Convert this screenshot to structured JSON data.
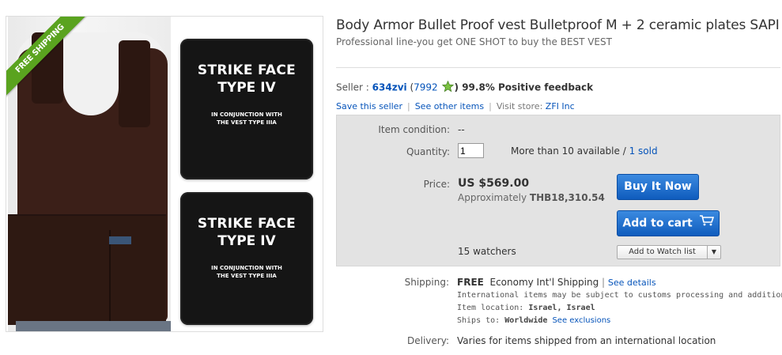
{
  "listing": {
    "title": "Body Armor Bullet Proof vest Bulletproof M + 2 ceramic plates SAPI",
    "subtitle": "Professional line-you get ONE SHOT to buy the BEST VEST"
  },
  "images": {
    "ribbon_text": "FREE SHIPPING",
    "plate_top": {
      "line1": "STRIKE FACE",
      "line2": "TYPE IV",
      "line3": "IN CONJUNCTION WITH",
      "line4": "THE VEST TYPE IIIA"
    },
    "plate_bottom": {
      "line1": "STRIKE FACE",
      "line2": "TYPE IV",
      "line3": "IN CONJUNCTION WITH",
      "line4": "THE VEST TYPE IIIA"
    }
  },
  "seller": {
    "label": "Seller :",
    "name": "634zvi",
    "score_open": "(",
    "score": "7992",
    "feedback": ") 99.8% Positive feedback",
    "star_icon": "green-star-icon",
    "save_link": "Save this seller",
    "other_link": "See other items",
    "store_label": "Visit store:",
    "store_link": "ZFI Inc",
    "separator": "|"
  },
  "buy_box": {
    "condition_label": "Item condition:",
    "condition_value": "--",
    "quantity_label": "Quantity:",
    "quantity_value": "1",
    "available_text": "More than 10 available /",
    "sold_link": "1 sold",
    "price_label": "Price:",
    "price_value": "US $569.00",
    "approx_label": "Approximately",
    "approx_value": "THB18,310.54",
    "buy_now_label": "Buy It Now",
    "add_cart_label": "Add to cart",
    "cart_icon": "shopping-cart-icon",
    "watchers_text": "15 watchers",
    "watch_label": "Add to Watch list",
    "watch_dropdown_icon": "triangle-down-icon"
  },
  "shipping": {
    "label": "Shipping:",
    "free": "FREE",
    "method": "Economy Int'l Shipping",
    "separator": "|",
    "details_link": "See details",
    "note": "International items may be subject to customs processing and additional",
    "location_label": "Item location:",
    "location_value": "Israel, Israel",
    "ships_label": "Ships to:",
    "ships_value": "Worldwide",
    "exclusions_link": "See exclusions",
    "delivery_label": "Delivery:",
    "delivery_value": "Varies for items shipped from an international location"
  },
  "colors": {
    "link": "#0654ba",
    "button": "#0f5cbd",
    "ribbon": "#5aa31f",
    "buybox_bg": "#e3e3e3"
  }
}
